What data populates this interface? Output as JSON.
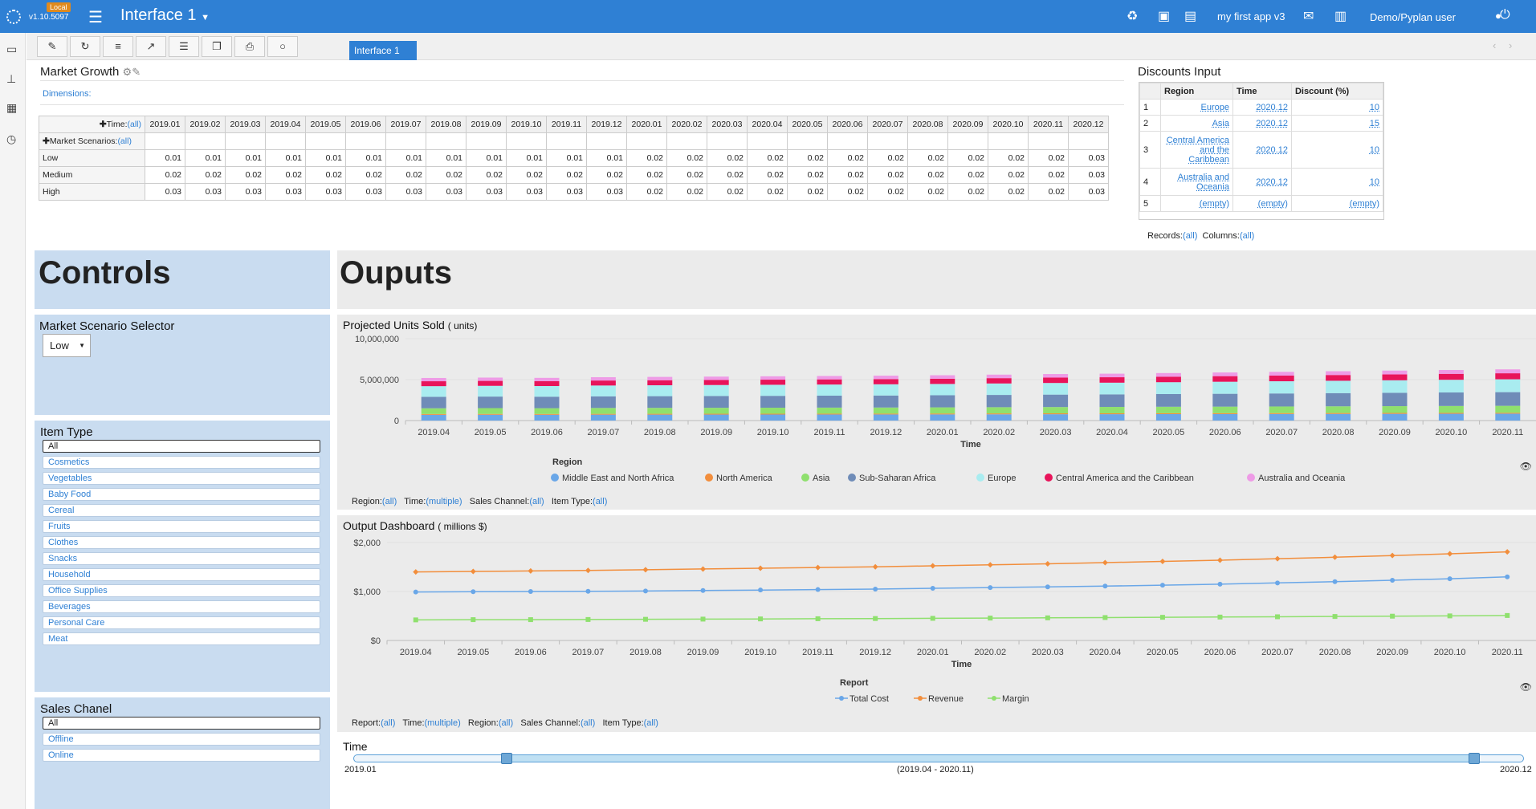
{
  "app": {
    "version": "v1.10.5097",
    "badge": "Local",
    "title": "Interface 1",
    "app_name": "my first app v3",
    "user": "Demo/Pyplan user"
  },
  "toolbar": {
    "tab": "Interface 1"
  },
  "market_growth": {
    "title": "Market Growth",
    "dimensions": "Dimensions:",
    "time_header": "Time:",
    "scen_header": "Market Scenarios:",
    "all": "(all)",
    "columns": [
      "2019.01",
      "2019.02",
      "2019.03",
      "2019.04",
      "2019.05",
      "2019.06",
      "2019.07",
      "2019.08",
      "2019.09",
      "2019.10",
      "2019.11",
      "2019.12",
      "2020.01",
      "2020.02",
      "2020.03",
      "2020.04",
      "2020.05",
      "2020.06",
      "2020.07",
      "2020.08",
      "2020.09",
      "2020.10",
      "2020.11",
      "2020.12"
    ],
    "rows": [
      {
        "label": "Low",
        "values": [
          "0.01",
          "0.01",
          "0.01",
          "0.01",
          "0.01",
          "0.01",
          "0.01",
          "0.01",
          "0.01",
          "0.01",
          "0.01",
          "0.01",
          "0.02",
          "0.02",
          "0.02",
          "0.02",
          "0.02",
          "0.02",
          "0.02",
          "0.02",
          "0.02",
          "0.02",
          "0.02",
          "0.03"
        ]
      },
      {
        "label": "Medium",
        "values": [
          "0.02",
          "0.02",
          "0.02",
          "0.02",
          "0.02",
          "0.02",
          "0.02",
          "0.02",
          "0.02",
          "0.02",
          "0.02",
          "0.02",
          "0.02",
          "0.02",
          "0.02",
          "0.02",
          "0.02",
          "0.02",
          "0.02",
          "0.02",
          "0.02",
          "0.02",
          "0.02",
          "0.03"
        ]
      },
      {
        "label": "High",
        "values": [
          "0.03",
          "0.03",
          "0.03",
          "0.03",
          "0.03",
          "0.03",
          "0.03",
          "0.03",
          "0.03",
          "0.03",
          "0.03",
          "0.03",
          "0.02",
          "0.02",
          "0.02",
          "0.02",
          "0.02",
          "0.02",
          "0.02",
          "0.02",
          "0.02",
          "0.02",
          "0.02",
          "0.03"
        ]
      }
    ]
  },
  "discounts": {
    "title": "Discounts Input",
    "headers": [
      "Region",
      "Time",
      "Discount (%)"
    ],
    "rows": [
      {
        "n": "1",
        "region": "Europe",
        "time": "2020.12",
        "discount": "10"
      },
      {
        "n": "2",
        "region": "Asia",
        "time": "2020.12",
        "discount": "15"
      },
      {
        "n": "3",
        "region": "Central America and the Caribbean",
        "time": "2020.12",
        "discount": "10"
      },
      {
        "n": "4",
        "region": "Australia and Oceania",
        "time": "2020.12",
        "discount": "10"
      },
      {
        "n": "5",
        "region": "(empty)",
        "time": "(empty)",
        "discount": "(empty)"
      }
    ],
    "footer_records": "Records:",
    "footer_columns": "Columns:",
    "all": "(all)"
  },
  "controls": {
    "heading": "Controls",
    "market_selector": {
      "title": "Market Scenario Selector",
      "value": "Low"
    },
    "item_type": {
      "title": "Item Type",
      "items": [
        "All",
        "Cosmetics",
        "Vegetables",
        "Baby Food",
        "Cereal",
        "Fruits",
        "Clothes",
        "Snacks",
        "Household",
        "Office Supplies",
        "Beverages",
        "Personal Care",
        "Meat"
      ]
    },
    "sales_channel": {
      "title": "Sales Chanel",
      "items": [
        "All",
        "Offline",
        "Online"
      ]
    }
  },
  "outputs": {
    "heading": "Ouputs",
    "units": {
      "title": "Projected Units Sold",
      "unit": "( units)",
      "filters": [
        [
          "Region:",
          "(all)"
        ],
        [
          "Time:",
          "(multiple)"
        ],
        [
          "Sales Channel:",
          "(all)"
        ],
        [
          "Item Type:",
          "(all)"
        ]
      ]
    },
    "dashboard": {
      "title": "Output Dashboard",
      "unit": "( millions $)",
      "filters": [
        [
          "Report:",
          "(all)"
        ],
        [
          "Time:",
          "(multiple)"
        ],
        [
          "Region:",
          "(all)"
        ],
        [
          "Sales Channel:",
          "(all)"
        ],
        [
          "Item Type:",
          "(all)"
        ]
      ]
    },
    "time_slider": {
      "title": "Time",
      "start": "2019.01",
      "end": "2020.12",
      "range": "(2019.04 - 2020.11)",
      "range_start": "2019.04",
      "range_end": "2020.11"
    }
  },
  "chart_data": [
    {
      "type": "bar",
      "stacked": true,
      "title": "Projected Units Sold",
      "unit": "( units)",
      "xlabel": "Time",
      "legend_title": "Region",
      "ylim": [
        0,
        10000000
      ],
      "yticks": [
        "0",
        "5,000,000",
        "10,000,000"
      ],
      "categories": [
        "2019.04",
        "2019.05",
        "2019.06",
        "2019.07",
        "2019.08",
        "2019.09",
        "2019.10",
        "2019.11",
        "2019.12",
        "2020.01",
        "2020.02",
        "2020.03",
        "2020.04",
        "2020.05",
        "2020.06",
        "2020.07",
        "2020.08",
        "2020.09",
        "2020.10",
        "2020.11"
      ],
      "series": [
        {
          "name": "Middle East and North Africa",
          "color": "#6aa7e8",
          "values": [
            700000,
            710000,
            705000,
            720000,
            725000,
            730000,
            735000,
            740000,
            745000,
            750000,
            760000,
            770000,
            775000,
            785000,
            790000,
            800000,
            810000,
            820000,
            830000,
            840000
          ]
        },
        {
          "name": "North America",
          "color": "#f28e3c",
          "values": [
            100000,
            100000,
            100000,
            100000,
            100000,
            100000,
            100000,
            100000,
            100000,
            110000,
            110000,
            110000,
            110000,
            110000,
            110000,
            110000,
            110000,
            110000,
            110000,
            110000
          ]
        },
        {
          "name": "Asia",
          "color": "#8fe06e",
          "values": [
            700000,
            710000,
            705000,
            720000,
            725000,
            730000,
            735000,
            740000,
            745000,
            750000,
            760000,
            770000,
            780000,
            790000,
            800000,
            810000,
            820000,
            830000,
            840000,
            850000
          ]
        },
        {
          "name": "Sub-Saharan Africa",
          "color": "#6f8cb8",
          "values": [
            1400000,
            1410000,
            1405000,
            1420000,
            1430000,
            1440000,
            1450000,
            1460000,
            1470000,
            1480000,
            1500000,
            1520000,
            1530000,
            1550000,
            1570000,
            1590000,
            1610000,
            1630000,
            1650000,
            1670000
          ]
        },
        {
          "name": "Europe",
          "color": "#a9ecf0",
          "values": [
            1300000,
            1310000,
            1300000,
            1320000,
            1330000,
            1340000,
            1350000,
            1360000,
            1370000,
            1380000,
            1400000,
            1420000,
            1430000,
            1450000,
            1470000,
            1490000,
            1510000,
            1530000,
            1550000,
            1570000
          ]
        },
        {
          "name": "Central America and the Caribbean",
          "color": "#e8145a",
          "values": [
            600000,
            605000,
            600000,
            610000,
            615000,
            620000,
            625000,
            630000,
            635000,
            640000,
            650000,
            660000,
            665000,
            675000,
            685000,
            695000,
            705000,
            715000,
            725000,
            735000
          ]
        },
        {
          "name": "Australia and Oceania",
          "color": "#ee9be6",
          "values": [
            400000,
            402000,
            400000,
            405000,
            408000,
            410000,
            413000,
            416000,
            419000,
            422000,
            428000,
            434000,
            437000,
            443000,
            449000,
            455000,
            461000,
            467000,
            473000,
            479000
          ]
        }
      ]
    },
    {
      "type": "line",
      "title": "Output Dashboard",
      "unit": "( millions $)",
      "xlabel": "Time",
      "legend_title": "Report",
      "ylim": [
        0,
        2000
      ],
      "yticks": [
        "$0",
        "$1,000",
        "$2,000"
      ],
      "categories": [
        "2019.04",
        "2019.05",
        "2019.06",
        "2019.07",
        "2019.08",
        "2019.09",
        "2019.10",
        "2019.11",
        "2019.12",
        "2020.01",
        "2020.02",
        "2020.03",
        "2020.04",
        "2020.05",
        "2020.06",
        "2020.07",
        "2020.08",
        "2020.09",
        "2020.10",
        "2020.11"
      ],
      "series": [
        {
          "name": "Total Cost",
          "color": "#6aa7e8",
          "marker": "circle",
          "values": [
            990,
            995,
            1000,
            1005,
            1010,
            1020,
            1030,
            1040,
            1050,
            1065,
            1080,
            1095,
            1110,
            1130,
            1150,
            1175,
            1200,
            1230,
            1260,
            1300
          ]
        },
        {
          "name": "Revenue",
          "color": "#f28e3c",
          "marker": "diamond",
          "values": [
            1400,
            1410,
            1420,
            1430,
            1445,
            1460,
            1475,
            1490,
            1505,
            1525,
            1545,
            1565,
            1590,
            1615,
            1640,
            1670,
            1700,
            1735,
            1770,
            1810
          ]
        },
        {
          "name": "Margin",
          "color": "#8fe06e",
          "marker": "square",
          "values": [
            420,
            425,
            425,
            428,
            432,
            436,
            440,
            444,
            448,
            452,
            457,
            462,
            468,
            473,
            478,
            484,
            490,
            496,
            502,
            510
          ]
        }
      ]
    }
  ]
}
